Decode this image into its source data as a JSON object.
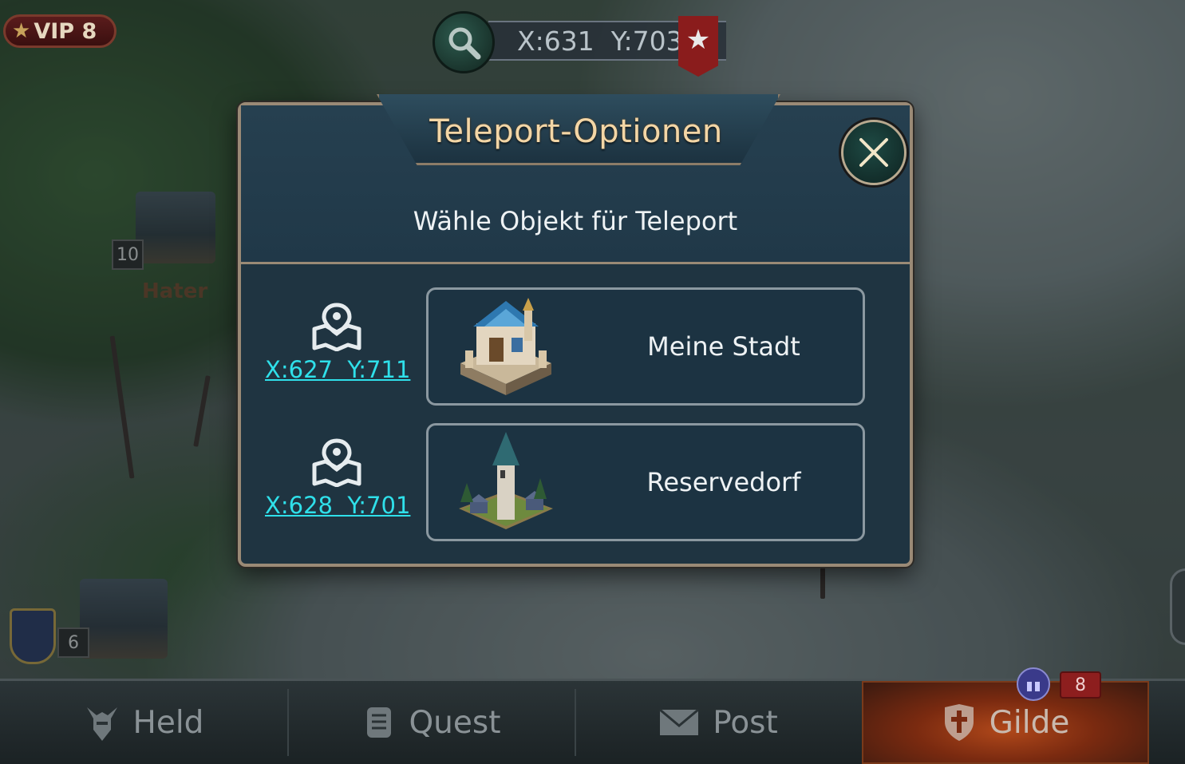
{
  "hud": {
    "vip_label": "VIP 8",
    "current_coords": "X:631  Y:703"
  },
  "map": {
    "labels": [
      {
        "level": "10",
        "name": "Hater"
      },
      {
        "level": "6",
        "name": ""
      }
    ]
  },
  "dialog": {
    "title": "Teleport-Optionen",
    "subtitle": "Wähle Objekt für Teleport",
    "options": [
      {
        "coords": "X:627  Y:711",
        "label": "Meine Stadt"
      },
      {
        "coords": "X:628  Y:701",
        "label": "Reservedorf"
      }
    ]
  },
  "nav": {
    "items": [
      {
        "label": "Held",
        "icon": "helmet-icon"
      },
      {
        "label": "Quest",
        "icon": "scroll-icon"
      },
      {
        "label": "Post",
        "icon": "envelope-icon"
      },
      {
        "label": "Gilde",
        "icon": "shield-cross-icon"
      }
    ],
    "guild_badge": "8"
  },
  "colors": {
    "link": "#2fe0ea",
    "title": "#f3d6a6",
    "dialog_bg": "#1f3441",
    "guild_active": "#b0481a"
  }
}
